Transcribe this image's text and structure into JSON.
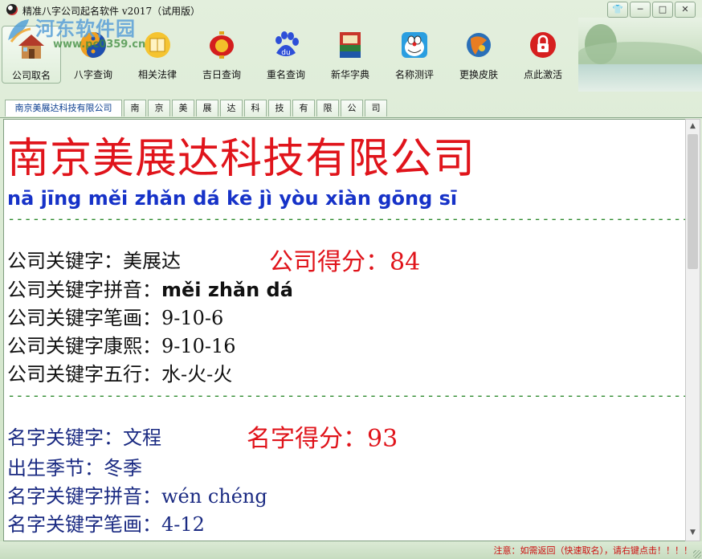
{
  "window": {
    "title": "精准八字公司起名软件 v2017（试用版）",
    "controls": {
      "skin": "👕",
      "minimize": "─",
      "maximize": "□",
      "close": "✕"
    }
  },
  "watermark": {
    "name": "河东软件园",
    "url": "www.pc0359.cn"
  },
  "toolbar": {
    "items": [
      {
        "label": "公司取名",
        "icon": "house-icon"
      },
      {
        "label": "八字查询",
        "icon": "yin-yang-icon"
      },
      {
        "label": "相关法律",
        "icon": "law-book-icon"
      },
      {
        "label": "吉日查询",
        "icon": "lantern-icon"
      },
      {
        "label": "重名查询",
        "icon": "baidu-paw-icon"
      },
      {
        "label": "新华字典",
        "icon": "dictionary-icon"
      },
      {
        "label": "名称测评",
        "icon": "doraemon-icon"
      },
      {
        "label": "更换皮肤",
        "icon": "palette-icon"
      },
      {
        "label": "点此激活",
        "icon": "lock-icon"
      }
    ]
  },
  "tabs": {
    "company": "南京美展达科技有限公司",
    "chars": [
      "南",
      "京",
      "美",
      "展",
      "达",
      "科",
      "技",
      "有",
      "限",
      "公",
      "司"
    ]
  },
  "content": {
    "company_name": "南京美展达科技有限公司",
    "company_pinyin": "nā jīng měi zhǎn dá kē jì yòu xiàn gōng sī",
    "divider": "--------------------------------------------------------------------------------------------",
    "company_keyword_label": "公司关键字：",
    "company_keyword": "美展达",
    "company_score_label": "公司得分：",
    "company_score": "84",
    "company_pinyin_label": "公司关键字拼音：",
    "company_keyword_pinyin": "měi zhǎn dá",
    "company_strokes_label": "公司关键字笔画：",
    "company_strokes": "9-10-6",
    "company_kangxi_label": "公司关键字康熙：",
    "company_kangxi": "9-10-16",
    "company_wuxing_label": "公司关键字五行：",
    "company_wuxing": "水-火-火",
    "name_keyword_label": "名字关键字：",
    "name_keyword": "文程",
    "name_score_label": "名字得分：",
    "name_score": "93",
    "season_label": "出生季节：",
    "season": "冬季",
    "name_pinyin_label": "名字关键字拼音：",
    "name_keyword_pinyin": "wén chéng",
    "name_strokes_label": "名字关键字笔画：",
    "name_strokes": "4-12"
  },
  "status": {
    "text": "注意：如需返回（快速取名），请右键点击！！！！"
  }
}
